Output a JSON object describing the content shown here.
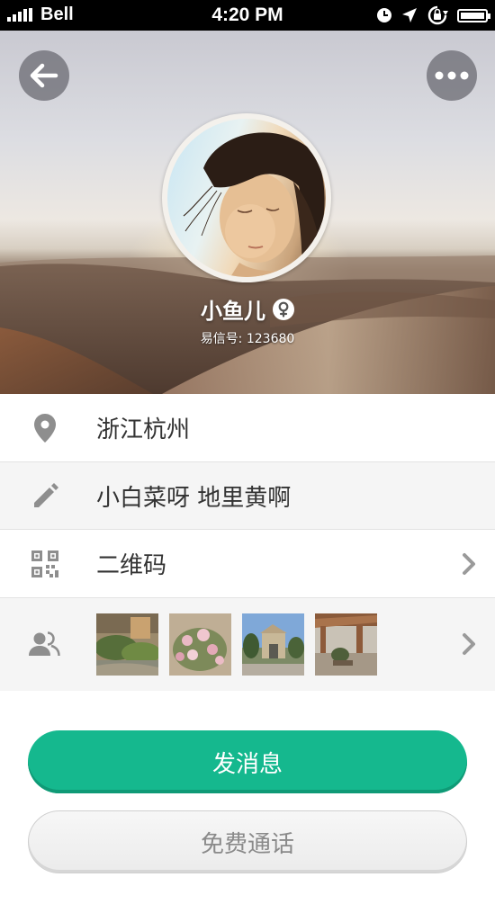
{
  "status_bar": {
    "carrier": "Bell",
    "time": "4:20 PM",
    "icons": [
      "signal-icon",
      "clock-icon",
      "location-arrow-icon",
      "rotation-lock-icon",
      "battery-icon"
    ]
  },
  "header": {
    "back_icon": "back-arrow-icon",
    "more_icon": "more-dots-icon"
  },
  "profile": {
    "name": "小鱼儿",
    "gender_icon": "female-icon",
    "yixin_id": "易信号: 123680"
  },
  "info": {
    "location": {
      "icon": "location-pin-icon",
      "text": "浙江杭州"
    },
    "signature": {
      "icon": "pencil-icon",
      "text": "小白菜呀 地里黄啊"
    },
    "qr_code": {
      "icon": "qr-code-icon",
      "text": "二维码",
      "chevron": "chevron-right-icon"
    },
    "album": {
      "icon": "contacts-icon",
      "photo_count_shown": 4,
      "chevron": "chevron-right-icon"
    }
  },
  "actions": {
    "send_message": "发消息",
    "free_call": "免费通话"
  },
  "colors": {
    "primary_green": "#15b88e",
    "row_alt_bg": "#f5f5f5",
    "icon_gray": "#8e8e8e"
  }
}
